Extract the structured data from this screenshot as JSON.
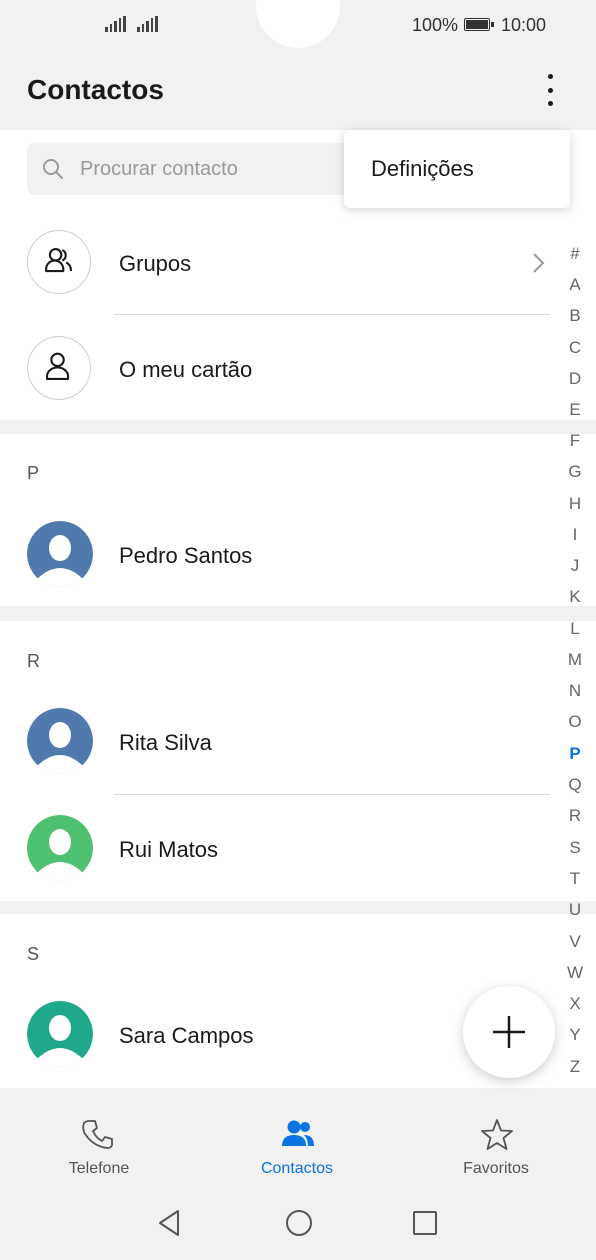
{
  "status": {
    "battery": "100%",
    "time": "10:00"
  },
  "header": {
    "title": "Contactos"
  },
  "search": {
    "placeholder": "Procurar contacto"
  },
  "overflow_menu": {
    "items": [
      "Definições"
    ]
  },
  "quick_rows": [
    {
      "label": "Grupos",
      "icon": "groups-icon"
    },
    {
      "label": "O meu cartão",
      "icon": "person-icon"
    }
  ],
  "sections": [
    {
      "letter": "P",
      "contacts": [
        {
          "name": "Pedro Santos",
          "color": "#5079ad"
        }
      ]
    },
    {
      "letter": "R",
      "contacts": [
        {
          "name": "Rita Silva",
          "color": "#5079ad"
        },
        {
          "name": "Rui Matos",
          "color": "#4fc070"
        }
      ]
    },
    {
      "letter": "S",
      "contacts": [
        {
          "name": "Sara Campos",
          "color": "#1fa88a"
        }
      ]
    }
  ],
  "index": {
    "letters": [
      "#",
      "A",
      "B",
      "C",
      "D",
      "E",
      "F",
      "G",
      "H",
      "I",
      "J",
      "K",
      "L",
      "M",
      "N",
      "O",
      "P",
      "Q",
      "R",
      "S",
      "T",
      "U",
      "V",
      "W",
      "X",
      "Y",
      "Z"
    ],
    "active": "P",
    "active_color": "#0a74e0"
  },
  "bottom_nav": [
    {
      "label": "Telefone",
      "icon": "phone-icon",
      "active": false
    },
    {
      "label": "Contactos",
      "icon": "contacts-icon",
      "active": true
    },
    {
      "label": "Favoritos",
      "icon": "star-icon",
      "active": false
    }
  ],
  "accent_color": "#0a74e0"
}
